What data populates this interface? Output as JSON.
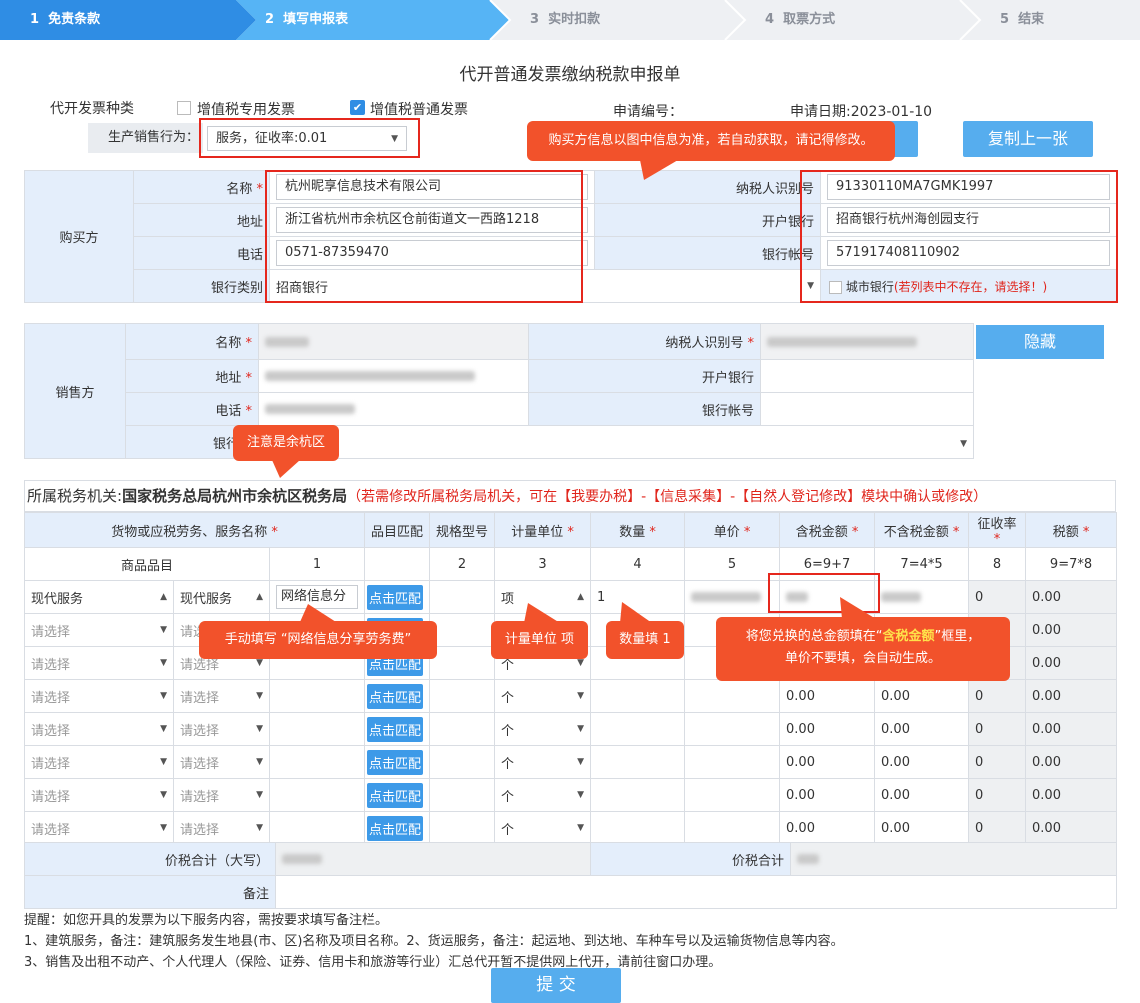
{
  "steps": [
    {
      "num": "1",
      "label": "免责条款"
    },
    {
      "num": "2",
      "label": "填写申报表"
    },
    {
      "num": "3",
      "label": "实时扣款"
    },
    {
      "num": "4",
      "label": "取票方式"
    },
    {
      "num": "5",
      "label": "结束"
    }
  ],
  "form_title": "代开普通发票缴纳税款申报单",
  "invoice_type": {
    "label": "代开发票种类",
    "option1": "增值税专用发票",
    "option2": "增值税普通发票"
  },
  "apply_no_label": "申请编号：",
  "apply_date": "申请日期:2023-01-10",
  "production": {
    "label": "生产销售行为：",
    "value": "服务，征收率:0.01"
  },
  "copy_button": "复制上一张",
  "buyer": {
    "section": "购买方",
    "name_label": "名称",
    "name": "杭州昵享信息技术有限公司",
    "address_label": "地址",
    "address": "浙江省杭州市余杭区仓前街道文一西路1218",
    "phone_label": "电话",
    "phone": "0571-87359470",
    "bank_type_label": "银行类别",
    "bank_type": "招商银行",
    "taxid_label": "纳税人识别号",
    "taxid": "91330110MA7GMK1997",
    "bank_label": "开户银行",
    "bank": "招商银行杭州海创园支行",
    "account_label": "银行帐号",
    "account": "571917408110902",
    "city_bank": "城市银行",
    "city_bank_note": "(若列表中不存在，请选择！)"
  },
  "seller": {
    "section": "销售方",
    "name_label": "名称",
    "address_label": "地址",
    "phone_label": "电话",
    "bank_type_label": "银行类",
    "taxid_label": "纳税人识别号",
    "bank_label": "开户银行",
    "account_label": "银行帐号",
    "hide_button": "隐藏"
  },
  "tax_office": {
    "label": "所属税务机关:",
    "value": "国家税务总局杭州市余杭区税务局",
    "note": "（若需修改所属税务局机关，可在【我要办税】-【信息采集】-【自然人登记修改】模块中确认或修改）"
  },
  "goods": {
    "headers": {
      "name": "货物或应税劳务、服务名称",
      "match": "品目匹配",
      "spec": "规格型号",
      "unit": "计量单位",
      "qty": "数量",
      "price": "单价",
      "amount": "含税金额",
      "noamount": "不含税金额",
      "rate": "征收率",
      "tax": "税额"
    },
    "subheaders": {
      "category": "商品品目",
      "n1": "1",
      "n2": "2",
      "n3": "3",
      "n4": "4",
      "n5": "5",
      "n6": "6=9+7",
      "n7": "7=4*5",
      "n8": "8",
      "n9": "9=7*8"
    },
    "first_row": {
      "cat1": "现代服务",
      "cat2": "现代服务",
      "name": "网络信息分",
      "match": "点击匹配",
      "unit": "项",
      "qty": "1",
      "rate": "0",
      "tax": "0.00"
    },
    "placeholder": "请选择",
    "placeholder_short": "请选",
    "match": "点击匹配",
    "unit_default": "个",
    "zero": "0.00",
    "zero_rate": "0",
    "total_caps_label": "价税合计（大写）",
    "total_label": "价税合计",
    "remark_label": "备注"
  },
  "callouts": {
    "buyer": "购买方信息以图中信息为准，若自动获取，请记得修改。",
    "district": "注意是余杭区",
    "name_fill": "手动填写 “网络信息分享劳务费”",
    "unit": "计量单位 项",
    "qty": "数量填 1",
    "amount_line1a": "将您兑换的总金额填在“",
    "amount_highlight": "含税金额",
    "amount_line1b": "”框里，",
    "amount_line2": "单价不要填，会自动生成。"
  },
  "notes": {
    "line1": "提醒：如您开具的发票为以下服务内容，需按要求填写备注栏。",
    "line2": "1、建筑服务，备注：建筑服务发生地县(市、区)名称及项目名称。2、货运服务，备注：起运地、到达地、车种车号以及运输货物信息等内容。",
    "line3": "3、销售及出租不动产、个人代理人（保险、证券、信用卡和旅游等行业）汇总代开暂不提供网上代开，请前往窗口办理。"
  },
  "submit": "提 交",
  "colors": {
    "accent": "#56adee",
    "active_step": "#2f8de4",
    "callout": "#f2522b",
    "highlight": "#e5271d"
  }
}
